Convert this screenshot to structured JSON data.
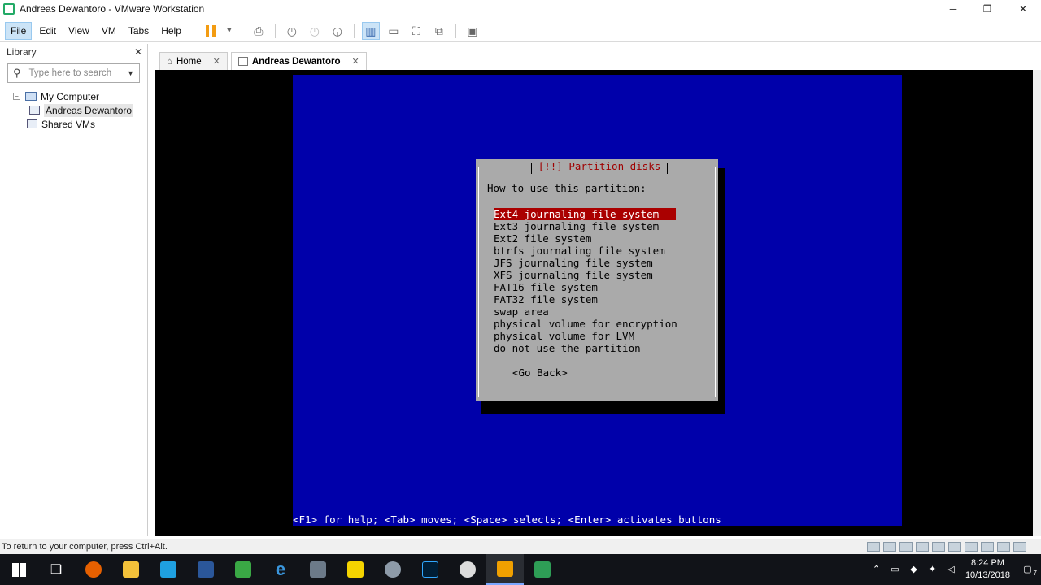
{
  "window": {
    "title": "Andreas Dewantoro - VMware Workstation",
    "minimize": "─",
    "restore": "❐",
    "close": "✕"
  },
  "menu": [
    "File",
    "Edit",
    "View",
    "VM",
    "Tabs",
    "Help"
  ],
  "library": {
    "title": "Library",
    "close": "✕",
    "search_placeholder": "Type here to search",
    "tree": {
      "root": "My Computer",
      "root_expander": "−",
      "child": "Andreas Dewantoro",
      "shared": "Shared VMs"
    }
  },
  "tabs": [
    {
      "label": "Home",
      "close": "✕"
    },
    {
      "label": "Andreas Dewantoro",
      "close": "✕"
    }
  ],
  "installer": {
    "dialog_title": "[!!] Partition disks",
    "question": "How to use this partition:",
    "options": [
      "Ext4 journaling file system",
      "Ext3 journaling file system",
      "Ext2 file system",
      "btrfs journaling file system",
      "JFS journaling file system",
      "XFS journaling file system",
      "FAT16 file system",
      "FAT32 file system",
      "swap area",
      "physical volume for encryption",
      "physical volume for LVM",
      "do not use the partition"
    ],
    "selected_index": 0,
    "go_back": "<Go Back>",
    "help_line": "<F1> for help; <Tab> moves; <Space> selects; <Enter> activates buttons"
  },
  "statusbar": {
    "text": "To return to your computer, press Ctrl+Alt."
  },
  "taskbar": {
    "time": "8:24 PM",
    "date": "10/13/2018",
    "notification_count": "7"
  },
  "colors": {
    "console_bg": "#0000aa",
    "dialog_bg": "#aaaaaa",
    "selection_bg": "#aa0000",
    "title_red": "#a00000"
  }
}
